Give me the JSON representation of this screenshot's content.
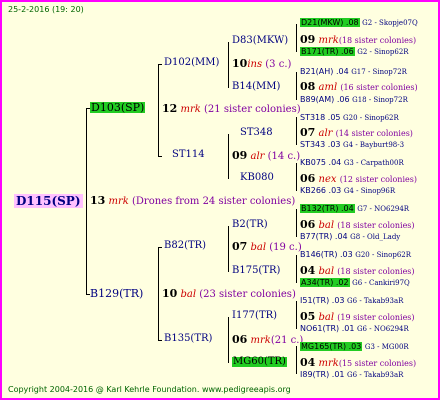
{
  "header": {
    "date": "25-2-2016 (19: 20)"
  },
  "footer": {
    "copyright": "Copyright 2004-2016 @ Karl Kehrle Foundation. www.pedigreeapis.org"
  },
  "pedigree": {
    "root": {
      "id": "D115(SP)",
      "gen": "13",
      "mrk": "mrk",
      "note": "(Drones from 24 sister colonies)"
    },
    "p": {
      "id": "D103(SP)",
      "gen": "12",
      "mrk": "mrk",
      "note": "(21 sister colonies)"
    },
    "m": {
      "id": "B129(TR)",
      "gen": "10",
      "mrk": "bal",
      "note": "(23 sister colonies)"
    },
    "pp": {
      "id": "D102(MM)",
      "gen": "10",
      "mrk": "ins",
      "note": "(3 c.)"
    },
    "pm": {
      "id": "ST114",
      "gen": "09",
      "mrk": "alr",
      "note": "(14 c.)"
    },
    "mp": {
      "id": "B82(TR)",
      "gen": "07",
      "mrk": "bal",
      "note": "(19 c.)"
    },
    "mm": {
      "id": "B135(TR)",
      "gen": "06",
      "mrk": "mrk",
      "note": "(21 c.)"
    },
    "ppp": {
      "id": "D83(MKW)",
      "gen": "09",
      "mrk": "mrk",
      "note": "(18 sister colonies)"
    },
    "ppm": {
      "id": "B14(MM)",
      "gen": "08",
      "mrk": "aml",
      "note": "(16 sister colonies)"
    },
    "pmp": {
      "id": "ST348",
      "gen": "07",
      "mrk": "alr",
      "note": "(14 sister colonies)"
    },
    "pmm": {
      "id": "KB080",
      "gen": "06",
      "mrk": "nex",
      "note": "(12 sister colonies)"
    },
    "mpp": {
      "id": "B2(TR)",
      "gen": "06",
      "mrk": "bal",
      "note": "(18 sister colonies)"
    },
    "mpm": {
      "id": "B175(TR)",
      "gen": "04",
      "mrk": "bal",
      "note": "(18 sister colonies)"
    },
    "mmp": {
      "id": "I177(TR)",
      "gen": "05",
      "mrk": "bal",
      "note": "(19 sister colonies)"
    },
    "mmm": {
      "id": "MG60(TR)",
      "gen": "04",
      "mrk": "mrk",
      "note": "(15 sister colonies)"
    },
    "g4": [
      {
        "left": "D21(MKW) .08",
        "right": "G2 - Skopje07Q"
      },
      {
        "left": "B171(TR) .06",
        "right": "G2 - Sinop62R"
      },
      {
        "left": "B21(AH) .04",
        "right": "G17 - Sinop72R"
      },
      {
        "left": "B89(AM) .06",
        "right": "G18 - Sinop72R"
      },
      {
        "left": "ST318 .05",
        "right": "G20 - Sinop62R"
      },
      {
        "left": "ST343 .03",
        "right": "G4 - Bayburt98-3"
      },
      {
        "left": "KB075 .04",
        "right": "G3 - Carpath00R"
      },
      {
        "left": "KB266 .03",
        "right": "G4 - Sinop96R"
      },
      {
        "left": "B132(TR) .04",
        "right": "G7 - NO6294R"
      },
      {
        "left": "B77(TR) .04",
        "right": "G8 - Old_Lady"
      },
      {
        "left": "B146(TR) .03",
        "right": "G20 - Sinop62R"
      },
      {
        "left": "A34(TR) .02",
        "right": "G6 - Cankiri97Q"
      },
      {
        "left": "I51(TR) .03",
        "right": "G6 - Takab93aR"
      },
      {
        "left": "NO61(TR) .01",
        "right": "G6 - NO6294R"
      },
      {
        "left": "MG165(TR) .03",
        "right": "G3 - MG00R"
      },
      {
        "left": "I89(TR) .01",
        "right": "G6 - Takab93aR"
      }
    ]
  }
}
